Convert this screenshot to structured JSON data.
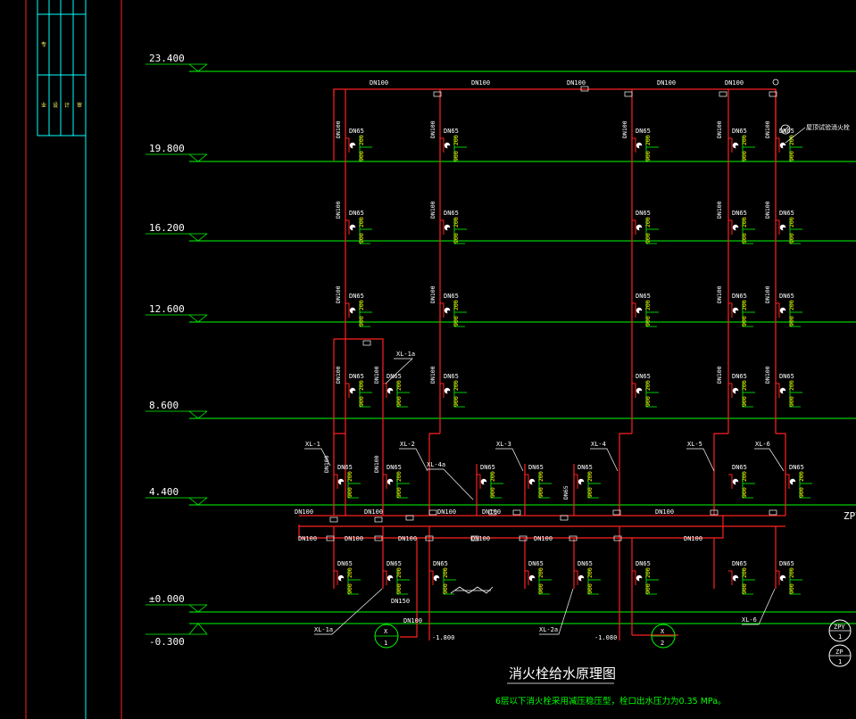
{
  "drawing": {
    "title": "消火栓给水原理图",
    "note": "6层以下消火栓采用减压稳压型，栓口出水压力为0.35 MPa。"
  },
  "title_block": {
    "cells": [
      "专",
      "业",
      "设",
      "计",
      "审"
    ]
  },
  "levels": [
    "23.400",
    "19.800",
    "16.200",
    "12.600",
    "8.600",
    "4.400",
    "±0.000",
    "-0.300"
  ],
  "riser_labels": [
    "XL-1",
    "XL-2",
    "XL-3",
    "XL-4",
    "XL-5",
    "XL-6",
    "XL-1a",
    "XL-2a",
    "XL-4a",
    "XL-6"
  ],
  "pipe_labels": {
    "dn100": "DN100",
    "dn65": "DN65",
    "dn150": "DN150",
    "v200": "200",
    "v900": "900"
  },
  "misc_labels": {
    "test_hydrant": "屋顶试验消火栓",
    "zpy": "ZPY",
    "inlet_x1": {
      "letter": "X",
      "num": "1"
    },
    "inlet_x2": {
      "letter": "X",
      "num": "2"
    },
    "inlet1_elev": "-1.800",
    "inlet2_elev": "-1.080",
    "legend_zpy": {
      "top": "ZPY",
      "num": "1"
    },
    "legend_zp": {
      "top": "ZP",
      "num": "1"
    }
  },
  "colors": {
    "background": "#000000",
    "pipe": "#ff2020",
    "level_line": "#00ff00",
    "frame": "#00ffff",
    "text": "#ffffff",
    "valve_text": "#ffff00"
  }
}
